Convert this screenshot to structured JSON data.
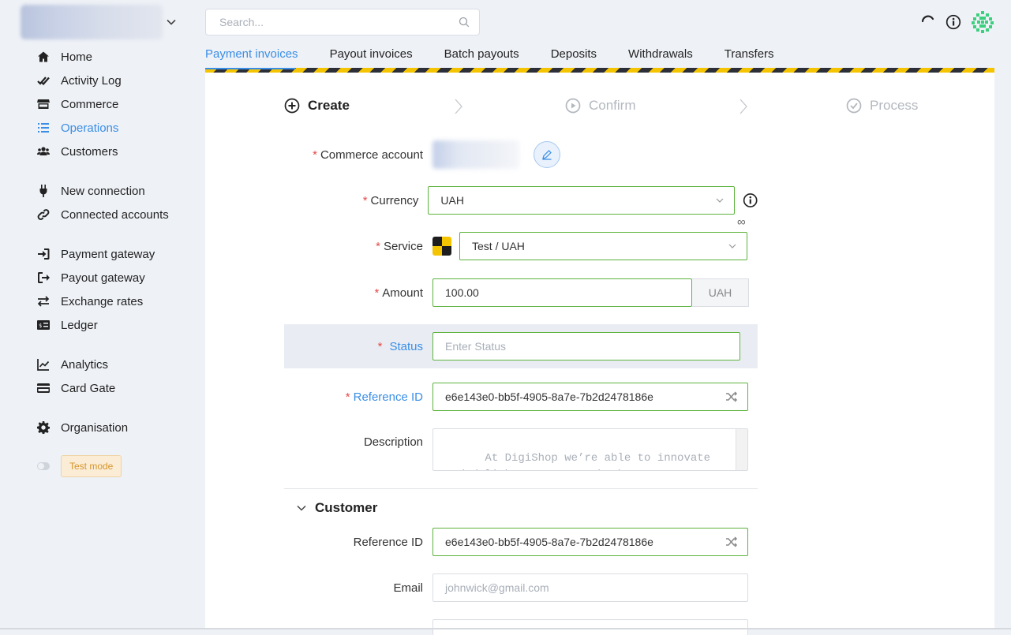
{
  "search": {
    "placeholder": "Search..."
  },
  "sidebar": {
    "items": [
      {
        "label": "Home",
        "icon": "home-icon"
      },
      {
        "label": "Activity Log",
        "icon": "check-double-icon"
      },
      {
        "label": "Commerce",
        "icon": "store-icon"
      },
      {
        "label": "Operations",
        "icon": "list-icon",
        "active": true
      },
      {
        "label": "Customers",
        "icon": "users-icon"
      },
      {
        "label": "New connection",
        "icon": "plug-icon"
      },
      {
        "label": "Connected accounts",
        "icon": "link-icon"
      },
      {
        "label": "Payment gateway",
        "icon": "sign-in-icon"
      },
      {
        "label": "Payout gateway",
        "icon": "sign-out-icon"
      },
      {
        "label": "Exchange rates",
        "icon": "exchange-icon"
      },
      {
        "label": "Ledger",
        "icon": "ledger-icon"
      },
      {
        "label": "Analytics",
        "icon": "chart-line-icon"
      },
      {
        "label": "Card Gate",
        "icon": "credit-card-icon"
      },
      {
        "label": "Organisation",
        "icon": "gear-icon"
      }
    ],
    "test_mode": "Test mode"
  },
  "tabs": [
    "Payment invoices",
    "Payout invoices",
    "Batch payouts",
    "Deposits",
    "Withdrawals",
    "Transfers"
  ],
  "steps": {
    "create": "Create",
    "confirm": "Confirm",
    "process": "Process"
  },
  "form": {
    "commerce_account_label": "Commerce account",
    "currency_label": "Currency",
    "currency_value": "UAH",
    "infinity": "∞",
    "service_label": "Service",
    "service_value": "Test / UAH",
    "amount_label": "Amount",
    "amount_value": "100.00",
    "amount_unit": "UAH",
    "status_label": "Status",
    "status_placeholder": "Enter Status",
    "reference_label": "Reference ID",
    "reference_value": "e6e143e0-bb5f-4905-8a7e-7b2d2478186e",
    "description_label": "Description",
    "description_placeholder": "At DigiShop we’re able to innovate and delight customers thanks to our"
  },
  "customer": {
    "title": "Customer",
    "reference_label": "Reference ID",
    "reference_value": "e6e143e0-bb5f-4905-8a7e-7b2d2478186e",
    "email_label": "Email",
    "email_placeholder": "johnwick@gmail.com"
  },
  "colors": {
    "accent": "#3a8ee6",
    "valid_border": "#5db33e",
    "required": "#e24a4a",
    "stripe_yellow": "#f4c400",
    "stripe_dark": "#2c2f38"
  }
}
